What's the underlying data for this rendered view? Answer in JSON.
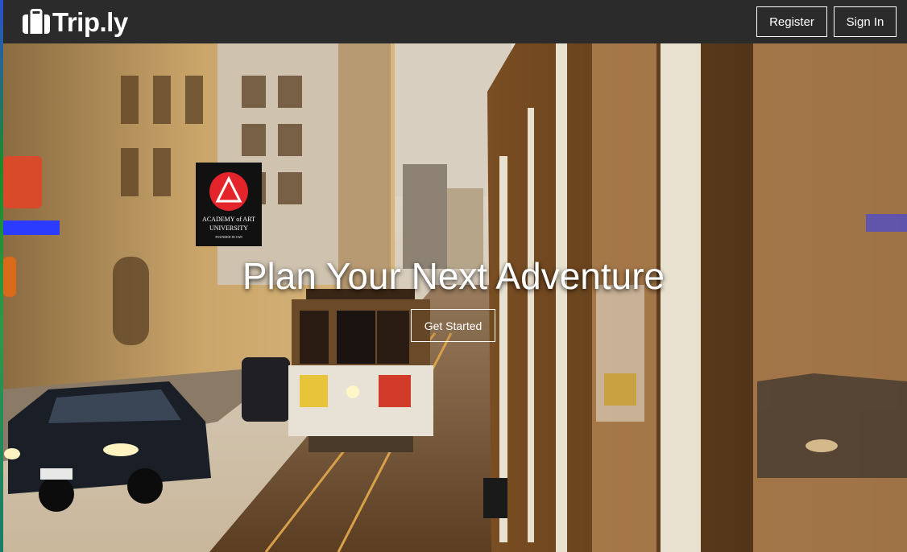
{
  "brand": {
    "name": "Trip.ly",
    "icon": "suitcase-icon"
  },
  "nav": {
    "register_label": "Register",
    "signin_label": "Sign In"
  },
  "hero": {
    "title": "Plan Your Next Adventure",
    "cta_label": "Get Started",
    "background": "cable-car-street-photo",
    "sign_lines": [
      "ACADEMY of ART",
      "UNIVERSITY",
      "FOUNDED IN 1929"
    ]
  },
  "colors": {
    "navbar_bg": "#2b2b2b",
    "text": "#ffffff",
    "sign_red": "#e3252b"
  }
}
